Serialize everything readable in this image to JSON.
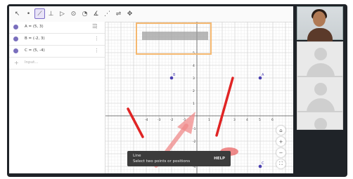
{
  "toolbar": {
    "tools": [
      {
        "icon": "pointer-icon",
        "glyph": "↖"
      },
      {
        "icon": "point-icon",
        "glyph": "•"
      },
      {
        "icon": "line-icon",
        "glyph": "⟋"
      },
      {
        "icon": "perpendicular-icon",
        "glyph": "⊥"
      },
      {
        "icon": "polygon-icon",
        "glyph": "▷"
      },
      {
        "icon": "circle-icon",
        "glyph": "⊙"
      },
      {
        "icon": "circle-arc-icon",
        "glyph": "◔"
      },
      {
        "icon": "angle-icon",
        "glyph": "∡"
      },
      {
        "icon": "reflect-icon",
        "glyph": "⋰"
      },
      {
        "icon": "slider-icon",
        "glyph": "⇌"
      },
      {
        "icon": "move-view-icon",
        "glyph": "✥"
      }
    ],
    "active_tool": "line-icon"
  },
  "algebra": {
    "rows": [
      {
        "text": "A = (5, 3)"
      },
      {
        "text": "B = (-2, 3)"
      },
      {
        "text": "C = (5, -4)"
      }
    ],
    "input_placeholder": "Input...",
    "point_color": "#7a6fbd"
  },
  "graphics": {
    "points": [
      {
        "label": "A",
        "x": 5,
        "y": 3
      },
      {
        "label": "B",
        "x": -2,
        "y": 3
      },
      {
        "label": "C",
        "x": 5,
        "y": -4
      }
    ],
    "x_ticks": [
      "-5",
      "-4",
      "-3",
      "-2",
      "-1",
      "1",
      "2",
      "3",
      "4",
      "5",
      "6"
    ],
    "y_ticks": [
      "5",
      "4",
      "3",
      "2",
      "1",
      "-1",
      "-2",
      "-3",
      "-4"
    ],
    "annotation_color": "#e02424",
    "highlight_color": "#f5b870"
  },
  "hint": {
    "title": "Line",
    "text": "Select two points or positions",
    "help": "HELP"
  },
  "sidebar_buttons": [
    "home-icon",
    "zoom-in-icon",
    "zoom-out-icon",
    "fullscreen-icon"
  ]
}
